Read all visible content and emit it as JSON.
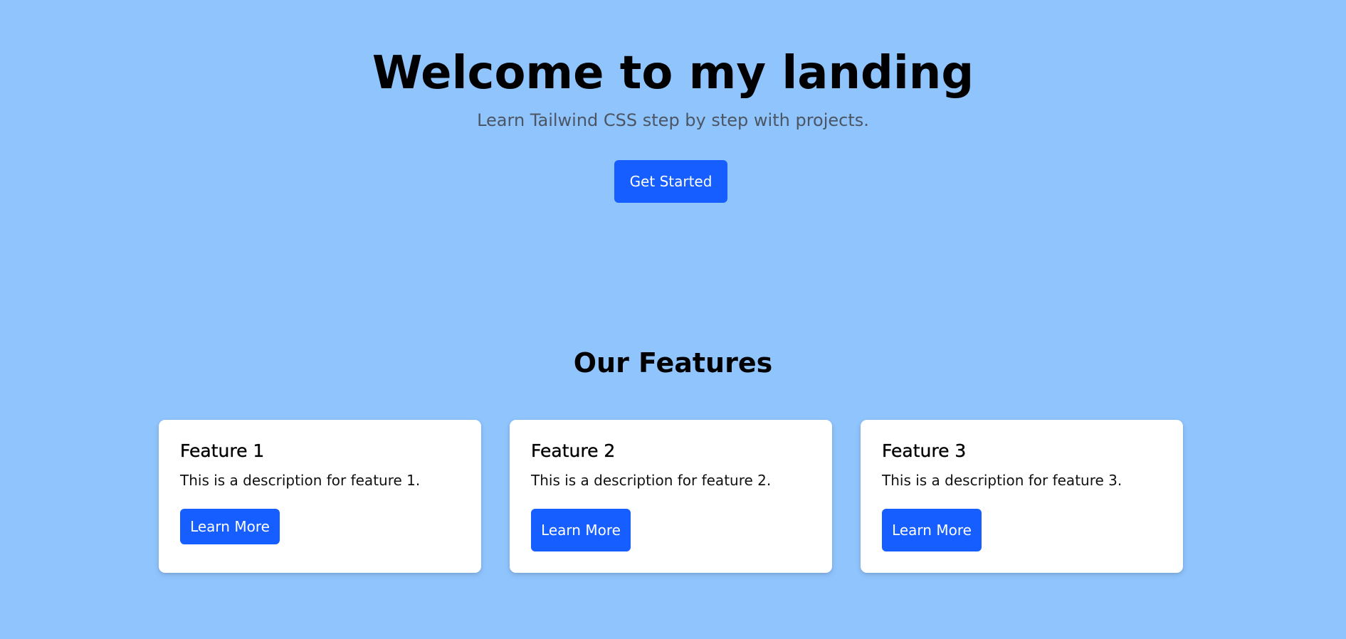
{
  "hero": {
    "title": "Welcome to my landing",
    "subtitle": "Learn Tailwind CSS step by step with projects.",
    "cta_label": "Get Started"
  },
  "features": {
    "heading": "Our Features",
    "items": [
      {
        "title": "Feature 1",
        "description": "This is a description for feature 1.",
        "button_label": "Learn More"
      },
      {
        "title": "Feature 2",
        "description": "This is a description for feature 2.",
        "button_label": "Learn More"
      },
      {
        "title": "Feature 3",
        "description": "This is a description for feature 3.",
        "button_label": "Learn More"
      }
    ]
  },
  "colors": {
    "background": "#90c4fd",
    "primary_button": "#165eff",
    "card_background": "#ffffff",
    "subtitle_text": "#4b5563"
  }
}
